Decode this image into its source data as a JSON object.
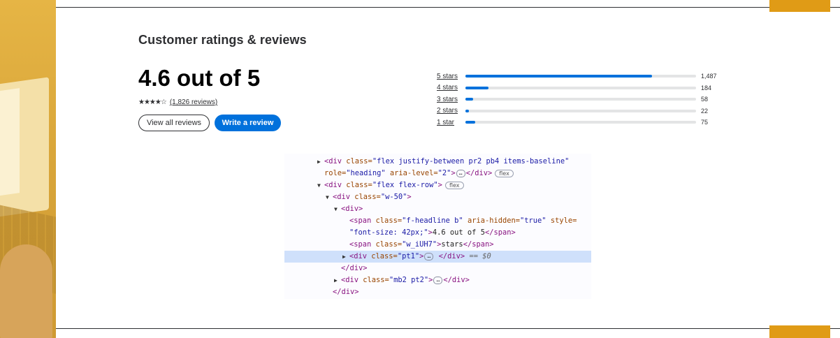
{
  "header": {
    "title": "Customer ratings & reviews"
  },
  "rating": {
    "headline": "4.6 out of 5",
    "stars_glyphs": "★★★★☆",
    "stars_value": 4.6,
    "review_count": "(1,826 reviews)"
  },
  "buttons": {
    "view_all": "View all reviews",
    "write": "Write a review"
  },
  "distribution": [
    {
      "label": "5 stars",
      "count": "1,487",
      "fraction": 0.81
    },
    {
      "label": "4 stars",
      "count": "184",
      "fraction": 0.1
    },
    {
      "label": "3 stars",
      "count": "58",
      "fraction": 0.032
    },
    {
      "label": "2 stars",
      "count": "22",
      "fraction": 0.012
    },
    {
      "label": "1 star",
      "count": "75",
      "fraction": 0.041
    }
  ],
  "colors": {
    "primary": "#0071dc",
    "accent": "#e09b16",
    "text": "#2e2f32"
  },
  "devtools": {
    "l1_tag_open": "<div ",
    "l1_attr": "class=",
    "l1_val": "\"flex justify-between pr2 pb4 items-baseline\"",
    "l2_attr1": "role=",
    "l2_val1": "\"heading\"",
    "l2_attr2": " aria-level=",
    "l2_val2": "\"2\"",
    "l2_close": "</div>",
    "badge_flex": "flex",
    "l3_tag_open": "<div ",
    "l3_attr": "class=",
    "l3_val": "\"flex flex-row\"",
    "l4_tag_open": "<div ",
    "l4_attr": "class=",
    "l4_val": "\"w-50\"",
    "l5_tag": "<div>",
    "l6_tag_open": "<span ",
    "l6_attr1": "class=",
    "l6_val1": "\"f-headline b\"",
    "l6_attr2": " aria-hidden=",
    "l6_val2": "\"true\"",
    "l6_attr3": " style=",
    "l7_val": "\"font-size: 42px;\"",
    "l7_text": "4.6 out of 5",
    "l7_close": "</span>",
    "l8_tag_open": "<span ",
    "l8_attr": "class=",
    "l8_val": "\"w_iUH7\"",
    "l8_text": "stars",
    "l8_close": "</span>",
    "l9_tag_open": "<div ",
    "l9_attr": "class=",
    "l9_val": "\"pt1\"",
    "l9_close": "</div>",
    "l9_dollar": "== $0",
    "l10_close": "</div>",
    "l11_tag_open": "<div ",
    "l11_attr": "class=",
    "l11_val": "\"mb2 pt2\"",
    "l11_close": "</div>",
    "l12_close": "</div>"
  }
}
